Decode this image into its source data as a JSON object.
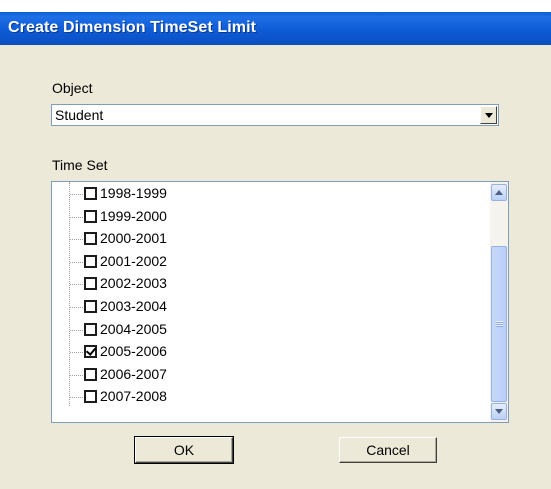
{
  "window": {
    "title": "Create Dimension TimeSet Limit"
  },
  "object": {
    "label": "Object",
    "selected": "Student"
  },
  "timeset": {
    "label": "Time Set",
    "items": [
      {
        "label": "1998-1999",
        "checked": false
      },
      {
        "label": "1999-2000",
        "checked": false
      },
      {
        "label": "2000-2001",
        "checked": false
      },
      {
        "label": "2001-2002",
        "checked": false
      },
      {
        "label": "2002-2003",
        "checked": false
      },
      {
        "label": "2003-2004",
        "checked": false
      },
      {
        "label": "2004-2005",
        "checked": false
      },
      {
        "label": "2005-2006",
        "checked": true
      },
      {
        "label": "2006-2007",
        "checked": false
      },
      {
        "label": "2007-2008",
        "checked": false
      }
    ]
  },
  "buttons": {
    "ok": "OK",
    "cancel": "Cancel"
  },
  "colors": {
    "titlebar": "#0a5ed7",
    "face": "#ece9d8"
  }
}
